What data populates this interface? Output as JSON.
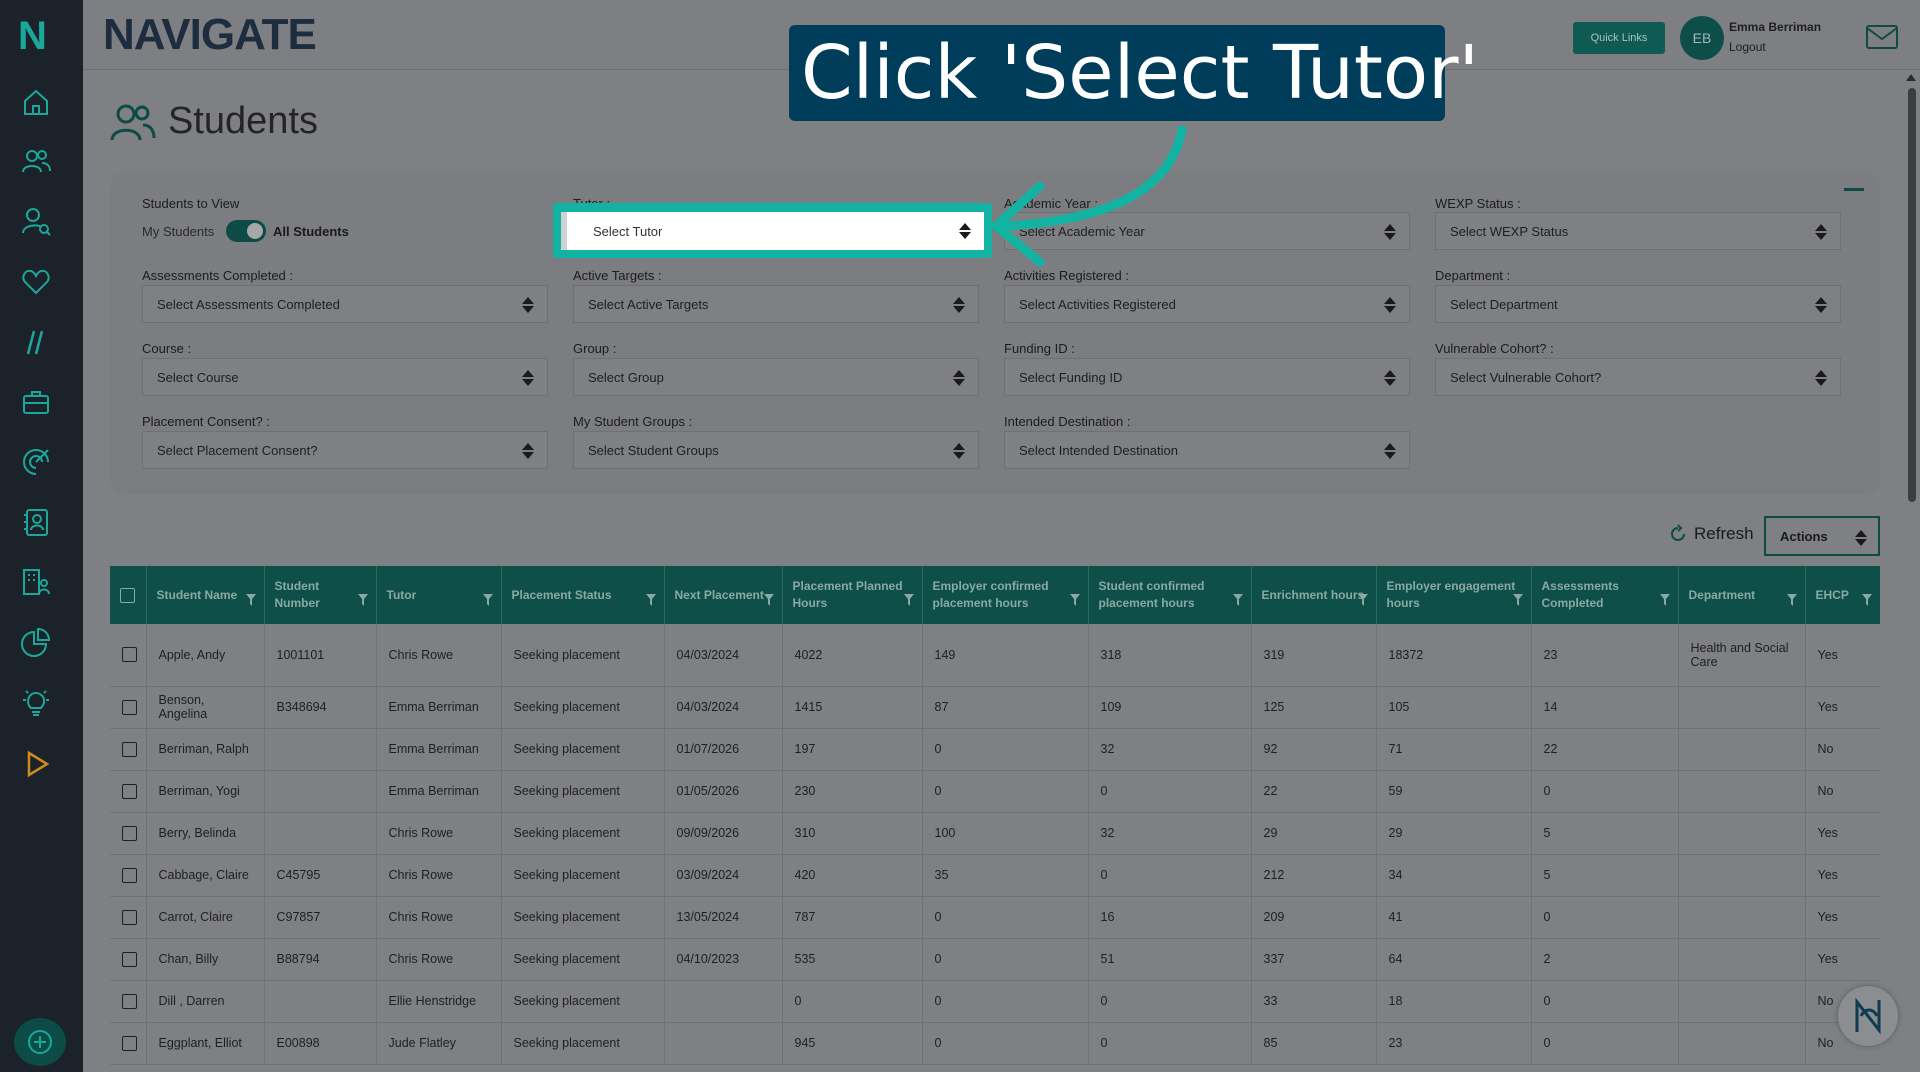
{
  "app": {
    "brand": "NAVIGATE",
    "sidebar_logo": "N"
  },
  "header": {
    "quick_links_label": "Quick Links",
    "user_initials": "EB",
    "user_name": "Emma Berriman",
    "logout_label": "Logout"
  },
  "page": {
    "title": "Students"
  },
  "callout": {
    "text": "Click 'Select Tutor'"
  },
  "filters": {
    "students_to_view_label": "Students to View",
    "my_students_label": "My Students",
    "all_students_label": "All Students",
    "tutor_label": "Tutor :",
    "tutor_placeholder": "Select Tutor",
    "academic_year_label": "Academic Year :",
    "academic_year_placeholder": "Select Academic Year",
    "wexp_label": "WEXP Status :",
    "wexp_placeholder": "Select WEXP Status",
    "assessments_label": "Assessments Completed :",
    "assessments_placeholder": "Select Assessments Completed",
    "active_targets_label": "Active Targets :",
    "active_targets_placeholder": "Select Active Targets",
    "activities_label": "Activities Registered :",
    "activities_placeholder": "Select Activities Registered",
    "department_label": "Department :",
    "department_placeholder": "Select Department",
    "course_label": "Course :",
    "course_placeholder": "Select Course",
    "group_label": "Group :",
    "group_placeholder": "Select Group",
    "funding_label": "Funding ID :",
    "funding_placeholder": "Select Funding ID",
    "vulnerable_label": "Vulnerable Cohort? :",
    "vulnerable_placeholder": "Select Vulnerable Cohort?",
    "placement_consent_label": "Placement Consent? :",
    "placement_consent_placeholder": "Select Placement Consent?",
    "student_groups_label": "My Student Groups :",
    "student_groups_placeholder": "Select Student Groups",
    "intended_label": "Intended Destination :",
    "intended_placeholder": "Select Intended Destination"
  },
  "toolbar": {
    "refresh_label": "Refresh",
    "actions_label": "Actions"
  },
  "table": {
    "columns": [
      "Student Name",
      "Student Number",
      "Tutor",
      "Placement Status",
      "Next Placement",
      "Placement Planned Hours",
      "Employer confirmed placement hours",
      "Student confirmed placement hours",
      "Enrichment hours",
      "Employer engagement hours",
      "Assessments Completed",
      "Department",
      "EHCP"
    ],
    "rows": [
      [
        "Apple, Andy",
        "1001101",
        "Chris Rowe",
        "Seeking placement",
        "04/03/2024",
        "4022",
        "149",
        "318",
        "319",
        "18372",
        "23",
        "Health and Social Care",
        "Yes"
      ],
      [
        "Benson, Angelina",
        "B348694",
        "Emma Berriman",
        "Seeking placement",
        "04/03/2024",
        "1415",
        "87",
        "109",
        "125",
        "105",
        "14",
        "",
        "Yes"
      ],
      [
        "Berriman, Ralph",
        "",
        "Emma Berriman",
        "Seeking placement",
        "01/07/2026",
        "197",
        "0",
        "32",
        "92",
        "71",
        "22",
        "",
        "No"
      ],
      [
        "Berriman, Yogi",
        "",
        "Emma Berriman",
        "Seeking placement",
        "01/05/2026",
        "230",
        "0",
        "0",
        "22",
        "59",
        "0",
        "",
        "No"
      ],
      [
        "Berry, Belinda",
        "",
        "Chris Rowe",
        "Seeking placement",
        "09/09/2026",
        "310",
        "100",
        "32",
        "29",
        "29",
        "5",
        "",
        "Yes"
      ],
      [
        "Cabbage, Claire",
        "C45795",
        "Chris Rowe",
        "Seeking placement",
        "03/09/2024",
        "420",
        "35",
        "0",
        "212",
        "34",
        "5",
        "",
        "Yes"
      ],
      [
        "Carrot, Claire",
        "C97857",
        "Chris Rowe",
        "Seeking placement",
        "13/05/2024",
        "787",
        "0",
        "16",
        "209",
        "41",
        "0",
        "",
        "Yes"
      ],
      [
        "Chan, Billy",
        "B88794",
        "Chris Rowe",
        "Seeking placement",
        "04/10/2023",
        "535",
        "0",
        "51",
        "337",
        "64",
        "2",
        "",
        "Yes"
      ],
      [
        "Dill , Darren",
        "",
        "Ellie Henstridge",
        "Seeking placement",
        "",
        "0",
        "0",
        "0",
        "33",
        "18",
        "0",
        "",
        "No"
      ],
      [
        "Eggplant, Elliot",
        "E00898",
        "Jude Flatley",
        "Seeking placement",
        "",
        "945",
        "0",
        "0",
        "85",
        "23",
        "0",
        "",
        "No"
      ]
    ]
  }
}
